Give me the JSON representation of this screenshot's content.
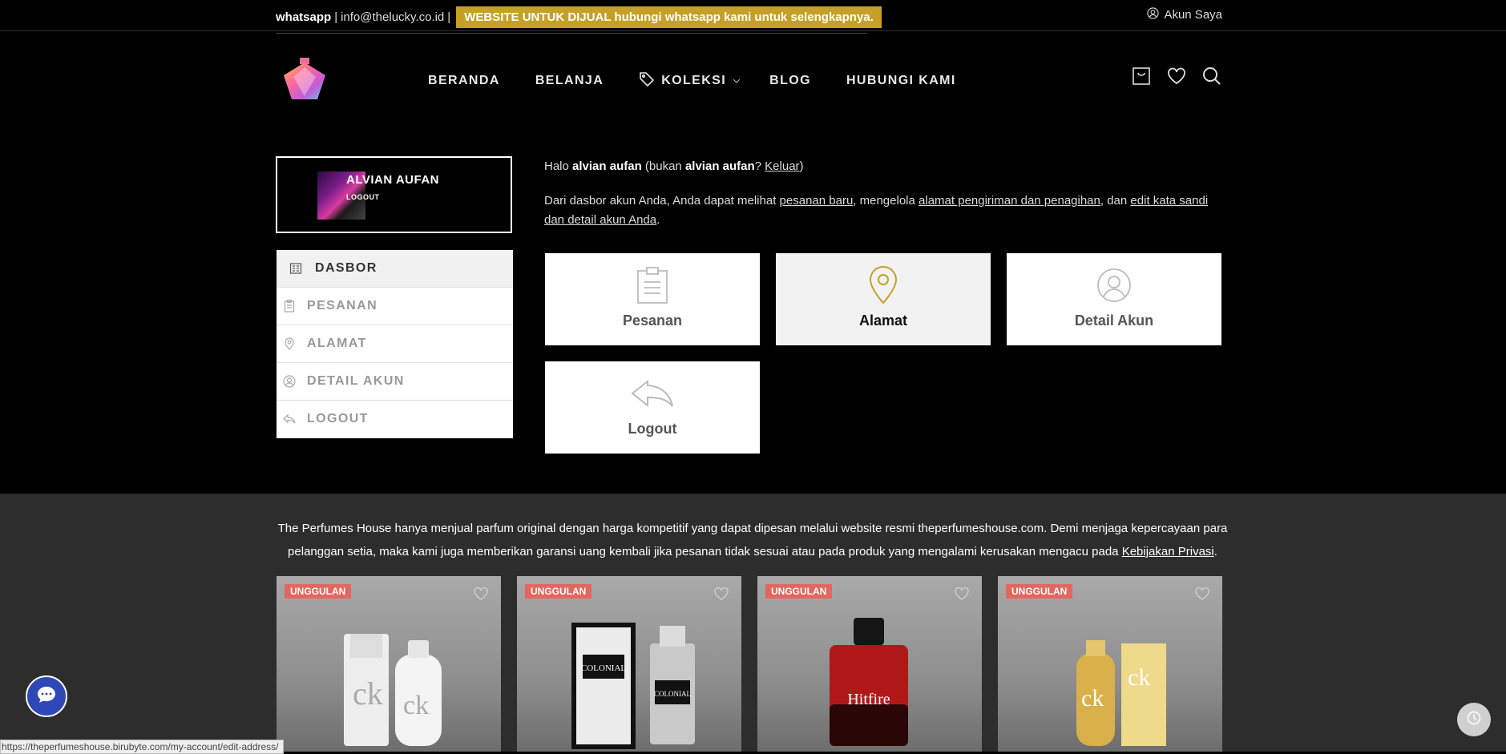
{
  "topbar": {
    "whatsapp": "whatsapp",
    "separator": "|",
    "email": "info@thelucky.co.id",
    "sale_banner": "WEBSITE UNTUK DIJUAL hubungi whatsapp kami untuk selengkapnya.",
    "account_link": "Akun Saya",
    "account_icon": "user-circle-icon"
  },
  "nav": {
    "items": [
      {
        "label": "BERANDA"
      },
      {
        "label": "BELANJA"
      },
      {
        "label": "KOLEKSI",
        "icon": "tag-icon"
      },
      {
        "label": "BLOG"
      },
      {
        "label": "HUBUNGI KAMI"
      }
    ],
    "icons": [
      "cart-icon",
      "heart-icon",
      "search-icon"
    ]
  },
  "profile": {
    "name": "ALVIAN AUFAN",
    "logout": "LOGOUT"
  },
  "side_menu": {
    "items": [
      {
        "label": "DASBOR",
        "icon": "dashboard-icon",
        "active": true
      },
      {
        "label": "PESANAN",
        "icon": "clipboard-icon"
      },
      {
        "label": "ALAMAT",
        "icon": "map-pin-icon"
      },
      {
        "label": "DETAIL AKUN",
        "icon": "user-icon"
      },
      {
        "label": "LOGOUT",
        "icon": "reply-icon"
      }
    ]
  },
  "greeting": {
    "hello": "Halo",
    "name": "alvian aufan",
    "not_text": "(bukan",
    "name2": "alvian aufan",
    "question": "?",
    "logout_link": "Keluar",
    "close": ")"
  },
  "intro": {
    "part1": "Dari dasbor akun Anda, Anda dapat melihat",
    "link1": "pesanan baru",
    "part2": ", mengelola",
    "link2": "alamat pengiriman dan penagihan",
    "part3": ", dan",
    "link3": "edit kata sandi dan detail akun Anda",
    "part4": "."
  },
  "dashboard_cards": [
    {
      "label": "Pesanan",
      "icon": "clipboard-icon"
    },
    {
      "label": "Alamat",
      "icon": "map-pin-icon"
    },
    {
      "label": "Detail Akun",
      "icon": "user-icon"
    },
    {
      "label": "Logout",
      "icon": "reply-icon"
    }
  ],
  "notice": {
    "text": "The Perfumes House hanya menjual parfum original dengan harga kompetitif yang dapat dipesan melalui website resmi theperfumeshouse.com. Demi menjaga kepercayaan para pelanggan setia, maka kami juga memberikan garansi uang kembali jika pesanan tidak sesuai atau pada produk yang mengalami kerusakan mengacu pada",
    "link": "Kebijakan Privasi",
    "end": "."
  },
  "products": [
    {
      "badge": "UNGGULAN"
    },
    {
      "badge": "UNGGULAN"
    },
    {
      "badge": "UNGGULAN"
    },
    {
      "badge": "UNGGULAN"
    }
  ],
  "status_url": "https://theperfumeshouse.birubyte.com/my-account/edit-address/",
  "colors": {
    "accent": "#c5a028",
    "badge": "#e3675f",
    "chat": "#2f48b8"
  }
}
